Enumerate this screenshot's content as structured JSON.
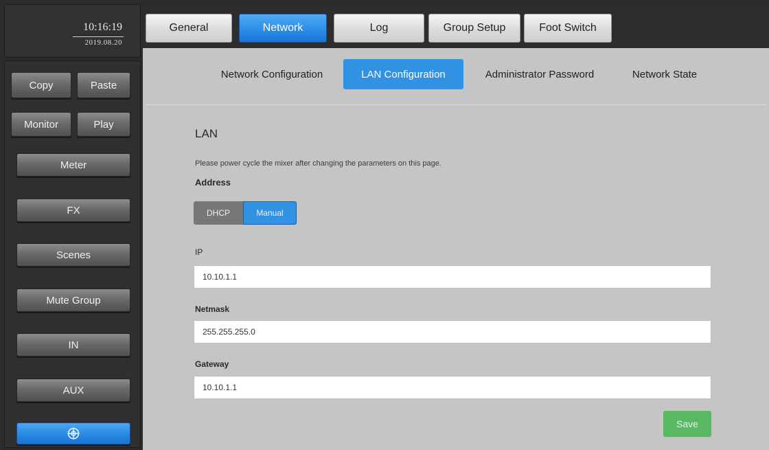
{
  "clock": {
    "time": "10:16:19",
    "date": "2019.08.20"
  },
  "sidebar": {
    "copy": "Copy",
    "paste": "Paste",
    "monitor": "Monitor",
    "play": "Play",
    "meter": "Meter",
    "fx": "FX",
    "scenes": "Scenes",
    "mute_group": "Mute Group",
    "in": "IN",
    "aux": "AUX",
    "bottom_icon": "globe-icon"
  },
  "top_tabs": {
    "general": "General",
    "network": "Network",
    "log": "Log",
    "group_setup": "Group Setup",
    "foot_switch": "Foot Switch",
    "active": "Network"
  },
  "sub_tabs": {
    "network_configuration": "Network Configuration",
    "lan_configuration": "LAN Configuration",
    "administrator_password": "Administrator Password",
    "network_state": "Network State",
    "active": "LAN Configuration"
  },
  "lan": {
    "title": "LAN",
    "note": "Please power cycle the mixer after changing the parameters on this page.",
    "address_label": "Address",
    "dhcp": "DHCP",
    "manual": "Manual",
    "address_mode": "Manual",
    "ip_label": "IP",
    "ip_value": "10.10.1.1",
    "netmask_label": "Netmask",
    "netmask_value": "255.255.255.0",
    "gateway_label": "Gateway",
    "gateway_value": "10.10.1.1",
    "save": "Save"
  },
  "colors": {
    "accent_blue": "#3191e3",
    "save_green": "#59b862",
    "panel_gray": "#c5c5c5",
    "sidebar_dark": "#2f2f2f"
  }
}
